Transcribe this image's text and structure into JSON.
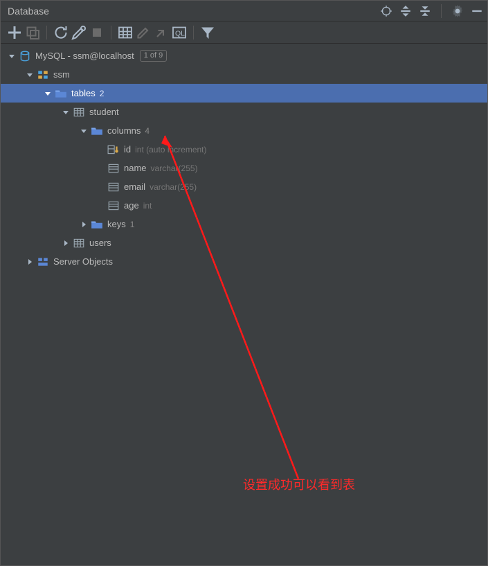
{
  "panel": {
    "title": "Database"
  },
  "tree": {
    "datasource": {
      "label": "MySQL - ssm@localhost",
      "badge": "1 of 9"
    },
    "schema": {
      "label": "ssm"
    },
    "tables": {
      "label": "tables",
      "count": "2"
    },
    "table_student": {
      "label": "student"
    },
    "columns": {
      "label": "columns",
      "count": "4"
    },
    "col_id": {
      "name": "id",
      "type": "int (auto increment)"
    },
    "col_name": {
      "name": "name",
      "type": "varchar(255)"
    },
    "col_email": {
      "name": "email",
      "type": "varchar(255)"
    },
    "col_age": {
      "name": "age",
      "type": "int"
    },
    "keys": {
      "label": "keys",
      "count": "1"
    },
    "table_users": {
      "label": "users"
    },
    "server_objects": {
      "label": "Server Objects"
    }
  },
  "annotation": {
    "text": "设置成功可以看到表"
  }
}
